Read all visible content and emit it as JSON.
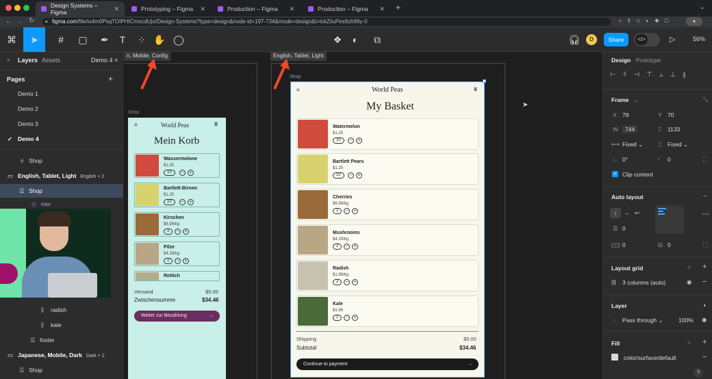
{
  "browser": {
    "tabs": [
      {
        "label": "Design Systems – Figma"
      },
      {
        "label": "Prototyping – Figma"
      },
      {
        "label": "Production – Figma"
      },
      {
        "label": "Production – Figma"
      }
    ],
    "new_tab": "+",
    "url_domain": "figma.com",
    "url_path": "/file/io4m0PsqTOIPHICmocdUjo/Design-Systems?type=design&node-id=197-734&mode=design&t=ickZiiuPes8zh96y-0"
  },
  "toolbar": {
    "zoom": "56%",
    "share_label": "Share",
    "avatar_initial": "D",
    "dev_icon": "</>"
  },
  "left_panel": {
    "tab_layers": "Layers",
    "tab_assets": "Assets",
    "page_selector": "Demo 4",
    "pages_heading": "Pages",
    "pages": [
      "Demo 1",
      "Demo 2",
      "Demo 3",
      "Demo 4"
    ],
    "layers": {
      "shop1": "Shop",
      "frame_english": "English, Tablet, Light",
      "frame_english_badge": "English + 2",
      "shop2": "Shop",
      "nav": "nav",
      "radish": "radish",
      "kale": "kale",
      "footer": "footer",
      "frame_japanese": "Japanese, Mobile, Dark",
      "frame_japanese_badge": "Dark + 2",
      "shop3": "Shop"
    }
  },
  "canvas": {
    "label_mobile": "n, Mobile, Config",
    "label_tablet": "English, Tablet, Light",
    "shop_label_mobile": "Shop",
    "shop_label_tablet": "Shop",
    "mobile": {
      "brand": "World Peas",
      "title": "Mein Korb",
      "items": [
        {
          "name": "Wassermelone",
          "price": "$1.25",
          "qty": "10"
        },
        {
          "name": "Bartlett-Birnen",
          "price": "$1.25",
          "qty": "10"
        },
        {
          "name": "Kirschen",
          "price": "$6.99/kg",
          "qty": "2"
        },
        {
          "name": "Pilze",
          "price": "$4.29/kg",
          "qty": "2"
        },
        {
          "name": "Rettich",
          "price": "",
          "qty": ""
        }
      ],
      "shipping_label": "Versand",
      "shipping_value": "$5.00",
      "subtotal_label": "Zwischensumme",
      "subtotal_value": "$34.46",
      "cta": "Weiter zur Bezahlung",
      "colors": {
        "bg": "#c8efe8",
        "cta": "#6b2c5f"
      }
    },
    "tablet": {
      "brand": "World Peas",
      "title": "My Basket",
      "items": [
        {
          "name": "Watermelon",
          "price": "$1.25",
          "qty": "10"
        },
        {
          "name": "Bartlett Pears",
          "price": "$1.25",
          "qty": "10"
        },
        {
          "name": "Cherries",
          "price": "$6.99/kg",
          "qty": "2"
        },
        {
          "name": "Mushrooms",
          "price": "$4.29/kg",
          "qty": "2"
        },
        {
          "name": "Radish",
          "price": "$1.99/kg",
          "qty": "2"
        },
        {
          "name": "Kale",
          "price": "$1.99",
          "qty": "2"
        }
      ],
      "shipping_label": "Shipping",
      "shipping_value": "$5.00",
      "subtotal_label": "Subtotal",
      "subtotal_value": "$34.46",
      "cta": "Continue to payment",
      "colors": {
        "bg": "#f6f6ea",
        "cta": "#1a1a1a"
      }
    }
  },
  "right_panel": {
    "tab_design": "Design",
    "tab_prototype": "Prototype",
    "frame_heading": "Frame",
    "x_label": "X",
    "x_value": "78",
    "y_label": "Y",
    "y_value": "70",
    "w_label": "W",
    "w_value": "744",
    "h_value": "1133",
    "resize_w": "Fixed",
    "resize_h": "Fixed",
    "rotation": "0°",
    "radius": "0",
    "clip_content": "Clip content",
    "auto_layout_heading": "Auto layout",
    "gap": "0",
    "padding_h": "0",
    "padding_v": "0",
    "layout_grid_heading": "Layout grid",
    "layout_grid_value": "3 columns (auto)",
    "layer_heading": "Layer",
    "blend_mode": "Pass through",
    "opacity": "100%",
    "fill_heading": "Fill",
    "fill_value": "color/surface/default",
    "help": "?"
  }
}
